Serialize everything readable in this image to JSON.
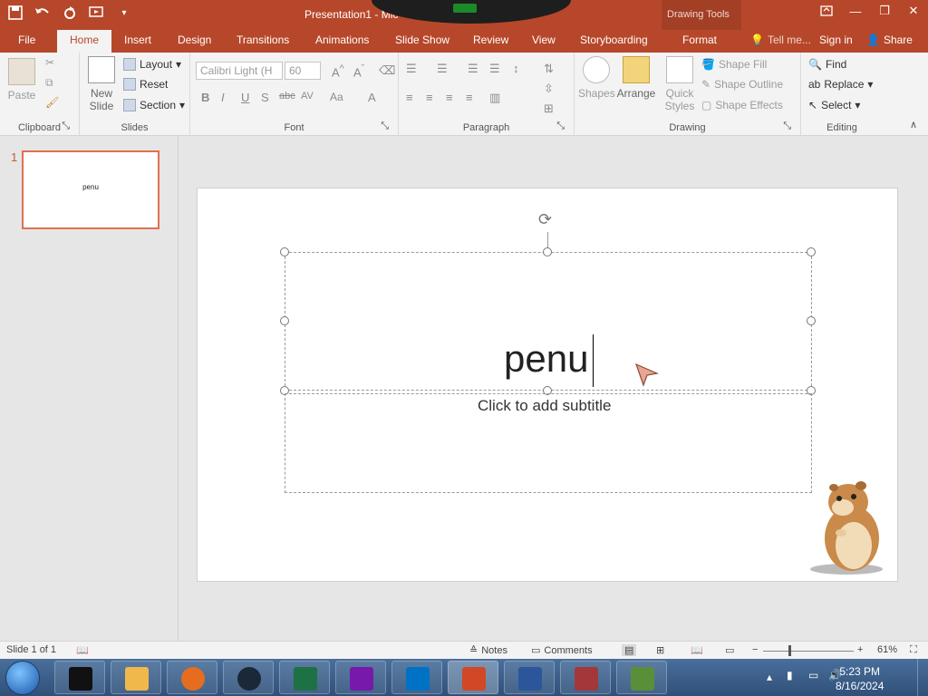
{
  "window": {
    "title": "Presentation1 - Microsoft PowerPoint",
    "title_visible": "Presentation1 - Mic",
    "contextual_label": "Drawing Tools",
    "accent": "#b7472a"
  },
  "tabs": {
    "file": "File",
    "home": "Home",
    "insert": "Insert",
    "design": "Design",
    "transitions": "Transitions",
    "animations": "Animations",
    "slideshow": "Slide Show",
    "review": "Review",
    "view": "View",
    "storyboarding": "Storyboarding",
    "format": "Format",
    "tellme": "Tell me...",
    "signin": "Sign in",
    "share": "Share"
  },
  "ribbon": {
    "clipboard": {
      "group": "Clipboard",
      "paste": "Paste"
    },
    "slides": {
      "group": "Slides",
      "new_slide_1": "New",
      "new_slide_2": "Slide",
      "layout": "Layout",
      "reset": "Reset",
      "section": "Section"
    },
    "font": {
      "group": "Font",
      "font_name": "Calibri Light (H",
      "font_size": "60"
    },
    "paragraph": {
      "group": "Paragraph"
    },
    "drawing": {
      "group": "Drawing",
      "shapes": "Shapes",
      "arrange": "Arrange",
      "quick_styles_1": "Quick",
      "quick_styles_2": "Styles",
      "shape_fill": "Shape Fill",
      "shape_outline": "Shape Outline",
      "shape_effects": "Shape Effects"
    },
    "editing": {
      "group": "Editing",
      "find": "Find",
      "replace": "Replace",
      "select": "Select"
    }
  },
  "thumbnails": [
    {
      "number": "1",
      "title": "penu"
    }
  ],
  "slide": {
    "title": "penu",
    "subtitle_placeholder": "Click to add subtitle"
  },
  "status": {
    "slide_of": "Slide 1 of 1",
    "notes": "Notes",
    "comments": "Comments",
    "zoom": "61%",
    "zoom_value": 61
  },
  "taskbar": {
    "time": "5:23 PM",
    "date": "8/16/2024",
    "apps": [
      "Terminal",
      "Media Player",
      "Firefox",
      "Steam",
      "Excel",
      "OneNote",
      "Outlook",
      "PowerPoint",
      "Word",
      "Access",
      "Minecraft"
    ]
  }
}
